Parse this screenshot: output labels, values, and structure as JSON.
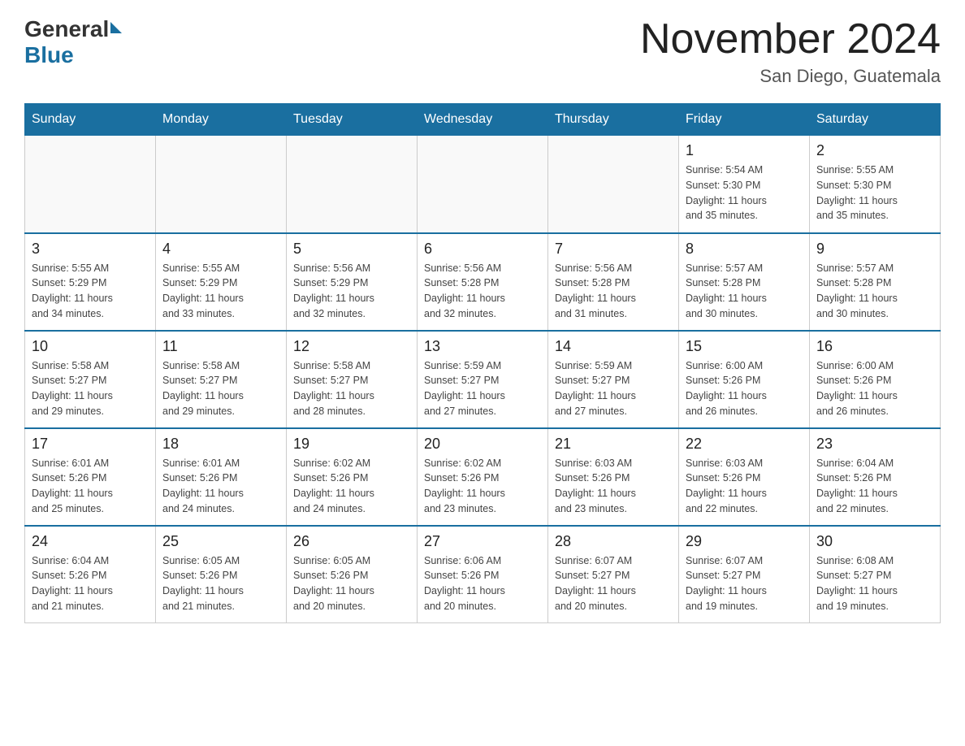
{
  "header": {
    "logo_general": "General",
    "logo_blue": "Blue",
    "title": "November 2024",
    "subtitle": "San Diego, Guatemala"
  },
  "weekdays": [
    "Sunday",
    "Monday",
    "Tuesday",
    "Wednesday",
    "Thursday",
    "Friday",
    "Saturday"
  ],
  "weeks": [
    [
      {
        "day": "",
        "info": ""
      },
      {
        "day": "",
        "info": ""
      },
      {
        "day": "",
        "info": ""
      },
      {
        "day": "",
        "info": ""
      },
      {
        "day": "",
        "info": ""
      },
      {
        "day": "1",
        "info": "Sunrise: 5:54 AM\nSunset: 5:30 PM\nDaylight: 11 hours\nand 35 minutes."
      },
      {
        "day": "2",
        "info": "Sunrise: 5:55 AM\nSunset: 5:30 PM\nDaylight: 11 hours\nand 35 minutes."
      }
    ],
    [
      {
        "day": "3",
        "info": "Sunrise: 5:55 AM\nSunset: 5:29 PM\nDaylight: 11 hours\nand 34 minutes."
      },
      {
        "day": "4",
        "info": "Sunrise: 5:55 AM\nSunset: 5:29 PM\nDaylight: 11 hours\nand 33 minutes."
      },
      {
        "day": "5",
        "info": "Sunrise: 5:56 AM\nSunset: 5:29 PM\nDaylight: 11 hours\nand 32 minutes."
      },
      {
        "day": "6",
        "info": "Sunrise: 5:56 AM\nSunset: 5:28 PM\nDaylight: 11 hours\nand 32 minutes."
      },
      {
        "day": "7",
        "info": "Sunrise: 5:56 AM\nSunset: 5:28 PM\nDaylight: 11 hours\nand 31 minutes."
      },
      {
        "day": "8",
        "info": "Sunrise: 5:57 AM\nSunset: 5:28 PM\nDaylight: 11 hours\nand 30 minutes."
      },
      {
        "day": "9",
        "info": "Sunrise: 5:57 AM\nSunset: 5:28 PM\nDaylight: 11 hours\nand 30 minutes."
      }
    ],
    [
      {
        "day": "10",
        "info": "Sunrise: 5:58 AM\nSunset: 5:27 PM\nDaylight: 11 hours\nand 29 minutes."
      },
      {
        "day": "11",
        "info": "Sunrise: 5:58 AM\nSunset: 5:27 PM\nDaylight: 11 hours\nand 29 minutes."
      },
      {
        "day": "12",
        "info": "Sunrise: 5:58 AM\nSunset: 5:27 PM\nDaylight: 11 hours\nand 28 minutes."
      },
      {
        "day": "13",
        "info": "Sunrise: 5:59 AM\nSunset: 5:27 PM\nDaylight: 11 hours\nand 27 minutes."
      },
      {
        "day": "14",
        "info": "Sunrise: 5:59 AM\nSunset: 5:27 PM\nDaylight: 11 hours\nand 27 minutes."
      },
      {
        "day": "15",
        "info": "Sunrise: 6:00 AM\nSunset: 5:26 PM\nDaylight: 11 hours\nand 26 minutes."
      },
      {
        "day": "16",
        "info": "Sunrise: 6:00 AM\nSunset: 5:26 PM\nDaylight: 11 hours\nand 26 minutes."
      }
    ],
    [
      {
        "day": "17",
        "info": "Sunrise: 6:01 AM\nSunset: 5:26 PM\nDaylight: 11 hours\nand 25 minutes."
      },
      {
        "day": "18",
        "info": "Sunrise: 6:01 AM\nSunset: 5:26 PM\nDaylight: 11 hours\nand 24 minutes."
      },
      {
        "day": "19",
        "info": "Sunrise: 6:02 AM\nSunset: 5:26 PM\nDaylight: 11 hours\nand 24 minutes."
      },
      {
        "day": "20",
        "info": "Sunrise: 6:02 AM\nSunset: 5:26 PM\nDaylight: 11 hours\nand 23 minutes."
      },
      {
        "day": "21",
        "info": "Sunrise: 6:03 AM\nSunset: 5:26 PM\nDaylight: 11 hours\nand 23 minutes."
      },
      {
        "day": "22",
        "info": "Sunrise: 6:03 AM\nSunset: 5:26 PM\nDaylight: 11 hours\nand 22 minutes."
      },
      {
        "day": "23",
        "info": "Sunrise: 6:04 AM\nSunset: 5:26 PM\nDaylight: 11 hours\nand 22 minutes."
      }
    ],
    [
      {
        "day": "24",
        "info": "Sunrise: 6:04 AM\nSunset: 5:26 PM\nDaylight: 11 hours\nand 21 minutes."
      },
      {
        "day": "25",
        "info": "Sunrise: 6:05 AM\nSunset: 5:26 PM\nDaylight: 11 hours\nand 21 minutes."
      },
      {
        "day": "26",
        "info": "Sunrise: 6:05 AM\nSunset: 5:26 PM\nDaylight: 11 hours\nand 20 minutes."
      },
      {
        "day": "27",
        "info": "Sunrise: 6:06 AM\nSunset: 5:26 PM\nDaylight: 11 hours\nand 20 minutes."
      },
      {
        "day": "28",
        "info": "Sunrise: 6:07 AM\nSunset: 5:27 PM\nDaylight: 11 hours\nand 20 minutes."
      },
      {
        "day": "29",
        "info": "Sunrise: 6:07 AM\nSunset: 5:27 PM\nDaylight: 11 hours\nand 19 minutes."
      },
      {
        "day": "30",
        "info": "Sunrise: 6:08 AM\nSunset: 5:27 PM\nDaylight: 11 hours\nand 19 minutes."
      }
    ]
  ]
}
